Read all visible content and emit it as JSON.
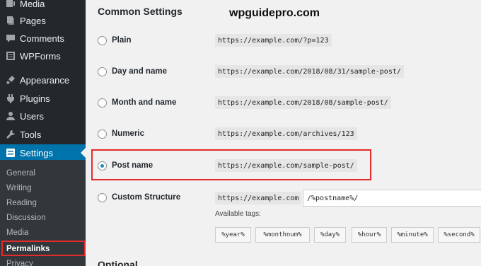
{
  "sidebar": {
    "items": [
      {
        "label": "Media",
        "icon": "media-icon"
      },
      {
        "label": "Pages",
        "icon": "pages-icon"
      },
      {
        "label": "Comments",
        "icon": "comments-icon"
      },
      {
        "label": "WPForms",
        "icon": "wpforms-icon"
      },
      {
        "label": "Appearance",
        "icon": "appearance-icon"
      },
      {
        "label": "Plugins",
        "icon": "plugins-icon"
      },
      {
        "label": "Users",
        "icon": "users-icon"
      },
      {
        "label": "Tools",
        "icon": "tools-icon"
      },
      {
        "label": "Settings",
        "icon": "settings-icon",
        "active": true
      }
    ],
    "submenu": [
      {
        "label": "General"
      },
      {
        "label": "Writing"
      },
      {
        "label": "Reading"
      },
      {
        "label": "Discussion"
      },
      {
        "label": "Media"
      },
      {
        "label": "Permalinks",
        "current": true
      },
      {
        "label": "Privacy"
      }
    ]
  },
  "main": {
    "section_title": "Common Settings",
    "watermark": "wpguidepro.com",
    "options": [
      {
        "label": "Plain",
        "example": "https://example.com/?p=123",
        "checked": false
      },
      {
        "label": "Day and name",
        "example": "https://example.com/2018/08/31/sample-post/",
        "checked": false
      },
      {
        "label": "Month and name",
        "example": "https://example.com/2018/08/sample-post/",
        "checked": false
      },
      {
        "label": "Numeric",
        "example": "https://example.com/archives/123",
        "checked": false
      },
      {
        "label": "Post name",
        "example": "https://example.com/sample-post/",
        "checked": true
      },
      {
        "label": "Custom Structure",
        "example": "https://example.com",
        "checked": false
      }
    ],
    "custom_structure_value": "/%postname%/",
    "available_tags_label": "Available tags:",
    "tags": [
      "%year%",
      "%monthnum%",
      "%day%",
      "%hour%",
      "%minute%",
      "%second%"
    ],
    "next_section_title": "Optional"
  },
  "colors": {
    "sidebar_bg": "#23282d",
    "active_bg": "#0073aa",
    "highlight": "#e22b2b",
    "page_bg": "#f1f1f1"
  }
}
